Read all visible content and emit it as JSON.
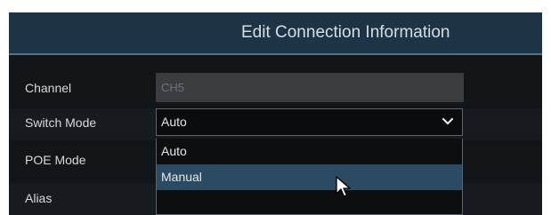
{
  "dialog": {
    "title": "Edit Connection Information"
  },
  "fields": {
    "channel": {
      "label": "Channel",
      "value": "CH5"
    },
    "switch_mode": {
      "label": "Switch Mode",
      "value": "Auto",
      "options": [
        "Auto",
        "Manual"
      ],
      "highlighted": "Manual"
    },
    "poe_mode": {
      "label": "POE Mode"
    },
    "alias": {
      "label": "Alias"
    }
  },
  "colors": {
    "title_bar": "#1d3447",
    "dialog_bg": "#121518",
    "highlight": "#2b4a63"
  },
  "icons": {
    "dropdown": "chevron-down-icon",
    "pointer": "mouse-pointer-icon"
  }
}
